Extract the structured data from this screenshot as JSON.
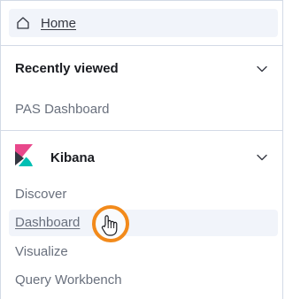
{
  "home": {
    "label": "Home",
    "icon": "home-icon"
  },
  "recently_viewed": {
    "title": "Recently viewed",
    "icon": "chevron-down-icon",
    "items": [
      {
        "label": "PAS Dashboard"
      }
    ]
  },
  "kibana": {
    "title": "Kibana",
    "logo": "kibana-logo-icon",
    "icon": "chevron-down-icon",
    "items": [
      {
        "label": "Discover"
      },
      {
        "label": "Dashboard"
      },
      {
        "label": "Visualize"
      },
      {
        "label": "Query Workbench"
      }
    ]
  },
  "colors": {
    "highlight_bg": "#f1f4fa",
    "cursor_ring": "#f28a1b",
    "kibana_pink": "#e8488b",
    "kibana_teal": "#00bfb3"
  }
}
